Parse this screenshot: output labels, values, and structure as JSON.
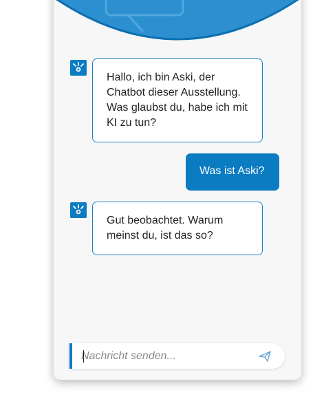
{
  "messages": [
    {
      "sender": "bot",
      "text": "Hallo, ich bin Aski, der Chatbot dieser Ausstellung. Was glaubst du, habe ich mit KI zu tun?"
    },
    {
      "sender": "user",
      "text": "Was ist Aski?"
    },
    {
      "sender": "bot",
      "text": "Gut beobachtet. Warum meinst du, ist das so?"
    }
  ],
  "input": {
    "placeholder": "Nachricht senden...",
    "value": ""
  },
  "icons": {
    "header": "chat-bubble-icon",
    "bot_avatar": "lightbulb-icon",
    "send": "paper-plane-icon"
  },
  "colors": {
    "accent": "#0b7cc2",
    "bubble_border": "#1f83c9",
    "background": "#f7f7f8"
  }
}
